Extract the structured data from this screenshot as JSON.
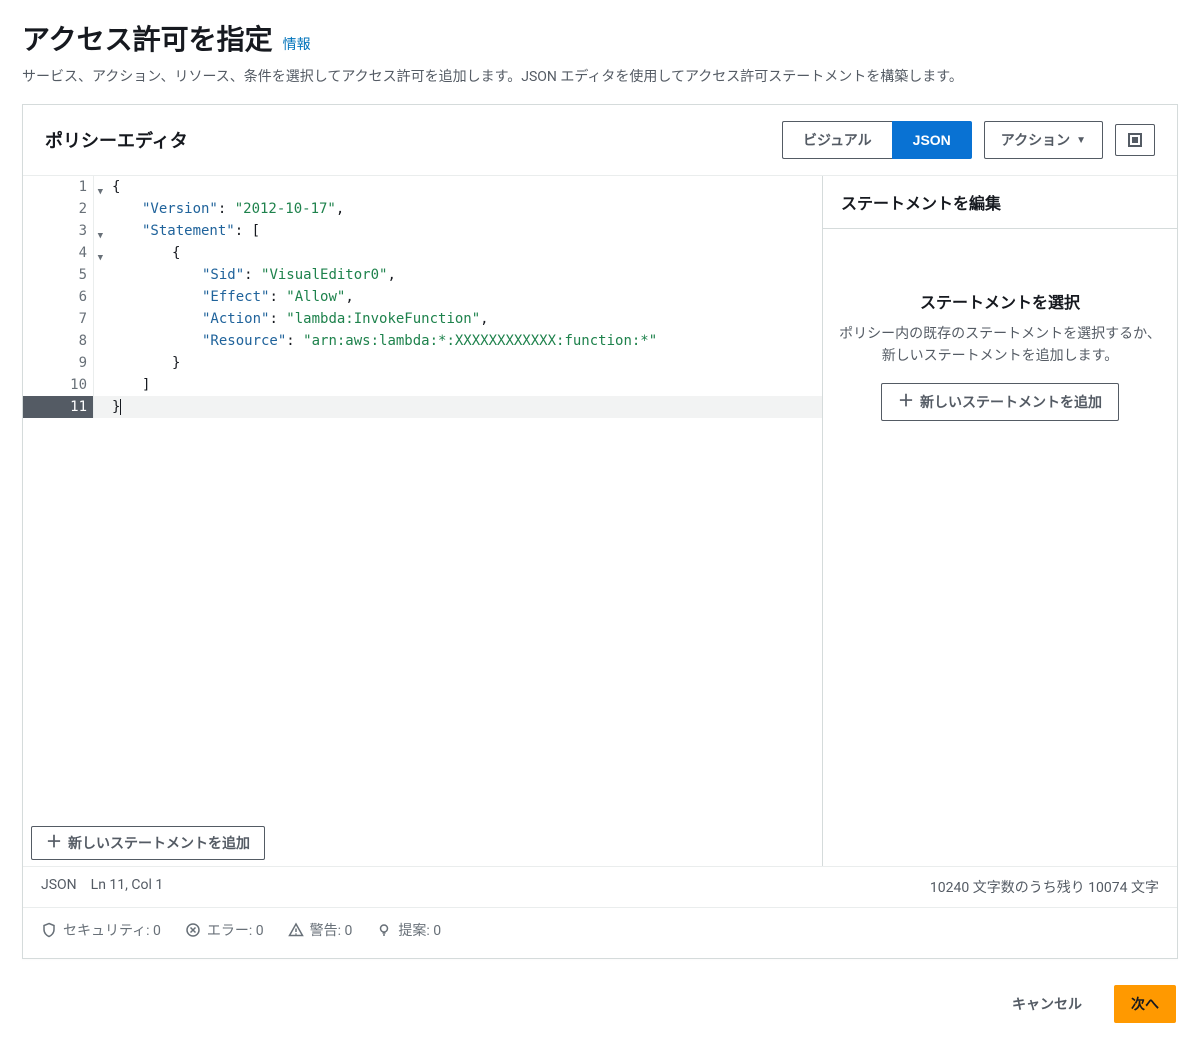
{
  "header": {
    "title": "アクセス許可を指定",
    "info_link": "情報",
    "subtitle": "サービス、アクション、リソース、条件を選択してアクセス許可を追加します。JSON エディタを使用してアクセス許可ステートメントを構築します。"
  },
  "panel": {
    "title": "ポリシーエディタ",
    "view_toggle": {
      "visual": "ビジュアル",
      "json": "JSON",
      "active": "json"
    },
    "actions_button": "アクション"
  },
  "code": {
    "lines": [
      {
        "n": 1,
        "fold": true,
        "tokens": [
          {
            "t": "punct",
            "v": "{"
          }
        ]
      },
      {
        "n": 2,
        "fold": false,
        "tokens": [
          {
            "t": "ind",
            "n": 1
          },
          {
            "t": "key",
            "v": "\"Version\""
          },
          {
            "t": "punct",
            "v": ": "
          },
          {
            "t": "str",
            "v": "\"2012-10-17\""
          },
          {
            "t": "punct",
            "v": ","
          }
        ]
      },
      {
        "n": 3,
        "fold": true,
        "tokens": [
          {
            "t": "ind",
            "n": 1
          },
          {
            "t": "key",
            "v": "\"Statement\""
          },
          {
            "t": "punct",
            "v": ": ["
          }
        ]
      },
      {
        "n": 4,
        "fold": true,
        "tokens": [
          {
            "t": "ind",
            "n": 2
          },
          {
            "t": "punct",
            "v": "{"
          }
        ]
      },
      {
        "n": 5,
        "fold": false,
        "tokens": [
          {
            "t": "ind",
            "n": 3
          },
          {
            "t": "key",
            "v": "\"Sid\""
          },
          {
            "t": "punct",
            "v": ": "
          },
          {
            "t": "str",
            "v": "\"VisualEditor0\""
          },
          {
            "t": "punct",
            "v": ","
          }
        ]
      },
      {
        "n": 6,
        "fold": false,
        "tokens": [
          {
            "t": "ind",
            "n": 3
          },
          {
            "t": "key",
            "v": "\"Effect\""
          },
          {
            "t": "punct",
            "v": ": "
          },
          {
            "t": "str",
            "v": "\"Allow\""
          },
          {
            "t": "punct",
            "v": ","
          }
        ]
      },
      {
        "n": 7,
        "fold": false,
        "tokens": [
          {
            "t": "ind",
            "n": 3
          },
          {
            "t": "key",
            "v": "\"Action\""
          },
          {
            "t": "punct",
            "v": ": "
          },
          {
            "t": "str",
            "v": "\"lambda:InvokeFunction\""
          },
          {
            "t": "punct",
            "v": ","
          }
        ]
      },
      {
        "n": 8,
        "fold": false,
        "tokens": [
          {
            "t": "ind",
            "n": 3
          },
          {
            "t": "key",
            "v": "\"Resource\""
          },
          {
            "t": "punct",
            "v": ": "
          },
          {
            "t": "str",
            "v": "\"arn:aws:lambda:*:XXXXXXXXXXXX:function:*\""
          }
        ]
      },
      {
        "n": 9,
        "fold": false,
        "tokens": [
          {
            "t": "ind",
            "n": 2
          },
          {
            "t": "punct",
            "v": "}"
          }
        ]
      },
      {
        "n": 10,
        "fold": false,
        "tokens": [
          {
            "t": "ind",
            "n": 1
          },
          {
            "t": "punct",
            "v": "]"
          }
        ]
      },
      {
        "n": 11,
        "fold": false,
        "hl": true,
        "cursor_after": true,
        "tokens": [
          {
            "t": "punct",
            "v": "}"
          }
        ]
      }
    ],
    "add_statement_button": "新しいステートメントを追加"
  },
  "sidebar": {
    "header": "ステートメントを編集",
    "empty_title": "ステートメントを選択",
    "empty_text": "ポリシー内の既存のステートメントを選択するか、新しいステートメントを追加します。",
    "add_button": "新しいステートメントを追加"
  },
  "status": {
    "mode": "JSON",
    "cursor": "Ln 11, Col 1",
    "chars": "10240 文字数のうち残り 10074 文字"
  },
  "diagnostics": {
    "security": "セキュリティ: 0",
    "errors": "エラー: 0",
    "warnings": "警告: 0",
    "suggestions": "提案: 0"
  },
  "footer": {
    "cancel": "キャンセル",
    "next": "次へ"
  }
}
